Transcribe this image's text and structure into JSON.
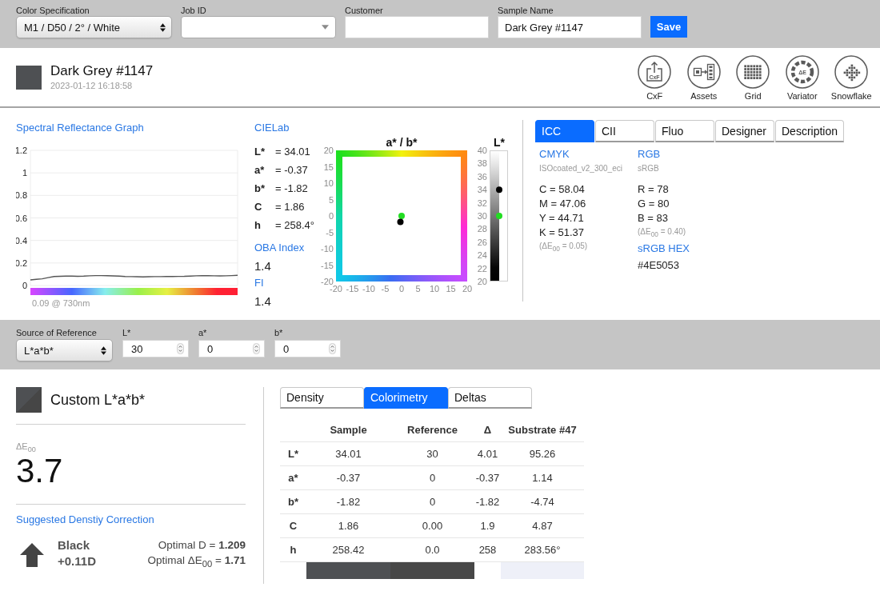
{
  "top_bar": {
    "fields": [
      {
        "kind": "select",
        "label": "Color Specification",
        "value": "M1 / D50 / 2° / White"
      },
      {
        "kind": "dropdown",
        "label": "Job ID"
      },
      {
        "kind": "text",
        "label": "Customer"
      },
      {
        "kind": "text",
        "label": "Sample Name",
        "value": "Dark Grey #1147"
      }
    ],
    "save_button": "Save"
  },
  "sample": {
    "color": "#4e5053",
    "name": "Dark Grey #1147",
    "timestamp": "2023-01-12 16:18:58"
  },
  "tools": [
    {
      "kind": "cxf",
      "label": "CxF",
      "icon_text": "CxF"
    },
    {
      "kind": "assets",
      "label": "Assets"
    },
    {
      "kind": "grid",
      "label": "Grid"
    },
    {
      "kind": "variator",
      "label": "Variator",
      "icon_text": "ΔE"
    },
    {
      "kind": "snowflake",
      "label": "Snowflake"
    }
  ],
  "spectral": {
    "title": "Spectral Reflectance Graph",
    "chart_data": {
      "type": "line",
      "grid": true,
      "ylim": [
        0,
        1.2
      ],
      "yticks": [
        0,
        0.2,
        0.4,
        0.6,
        0.8,
        1,
        1.2
      ],
      "series": [
        {
          "color": "#555555",
          "values": [
            0.05,
            0.055,
            0.06,
            0.07,
            0.08,
            0.082,
            0.083,
            0.083,
            0.082,
            0.083,
            0.086,
            0.088,
            0.088,
            0.087,
            0.085,
            0.083,
            0.08,
            0.079,
            0.078,
            0.077,
            0.078,
            0.079,
            0.079,
            0.08,
            0.08,
            0.081,
            0.082,
            0.084,
            0.086,
            0.087,
            0.087,
            0.086,
            0.085,
            0.086,
            0.088,
            0.09
          ]
        }
      ]
    },
    "reading": "0.09 @ 730nm"
  },
  "cielab": {
    "title": "CIELab",
    "rows": [
      {
        "label": "L*",
        "value": "= 34.01"
      },
      {
        "label": "a*",
        "value": "= -0.37"
      },
      {
        "label": "b*",
        "value": "= -1.82"
      },
      {
        "label": "C",
        "value": "= 1.86"
      },
      {
        "label": "h",
        "value": "= 258.4°"
      }
    ],
    "oba": {
      "title": "OBA Index",
      "value": "1.4"
    },
    "fi": {
      "title": "FI",
      "value": "1.4"
    }
  },
  "ab_plot": {
    "chart_data": {
      "type": "scatter",
      "title": "a* / b*",
      "xlim": [
        -20,
        20
      ],
      "ylim": [
        -20,
        20
      ],
      "xticks": [
        -20,
        -15,
        -10,
        -5,
        0,
        5,
        10,
        15,
        20
      ],
      "yticks": [
        -20,
        -15,
        -10,
        -5,
        0,
        5,
        10,
        15,
        20
      ],
      "series": [
        {
          "color": "#000000",
          "x": [
            -0.37
          ],
          "values": [
            -1.82
          ]
        },
        {
          "color": "#22dd22",
          "x": [
            0
          ],
          "values": [
            0
          ]
        }
      ]
    }
  },
  "l_scale": {
    "title": "L*",
    "ticks": [
      "40",
      "38",
      "36",
      "34",
      "32",
      "30",
      "28",
      "26",
      "24",
      "22",
      "20"
    ],
    "markers": [
      {
        "color": "#000000",
        "level": 0.7
      },
      {
        "color": "#22dd22",
        "level": 0.5
      }
    ]
  },
  "icc_panel": {
    "tabs": [
      {
        "label": "ICC",
        "selected": true
      },
      {
        "label": "CII",
        "selected": false
      },
      {
        "label": "Fluo",
        "selected": false
      },
      {
        "label": "Designer",
        "selected": false
      },
      {
        "label": "Description",
        "selected": false
      }
    ],
    "cmyk": {
      "title": "CMYK",
      "profile": "ISOcoated_v2_300_eci",
      "values": [
        "C = 58.04",
        "M = 47.06",
        "Y = 44.71",
        "K = 51.37"
      ],
      "delta": "(ΔE$_{00}$ = 0.05)"
    },
    "rgb": {
      "title": "RGB",
      "profile": "sRGB",
      "values": [
        "R = 78",
        "G = 80",
        "B = 83"
      ],
      "delta": "(ΔE$_{00}$ = 0.40)"
    },
    "hex": {
      "title": "sRGB HEX",
      "value": "#4E5053"
    }
  },
  "reference_bar": {
    "source": {
      "label": "Source of Reference",
      "value": "L*a*b*"
    },
    "inputs": [
      {
        "label": "L*",
        "value": "30"
      },
      {
        "label": "a*",
        "value": "0"
      },
      {
        "label": "b*",
        "value": "0"
      }
    ]
  },
  "reference": {
    "color": "#464646",
    "name": "Custom L*a*b*",
    "delta_label": "ΔE$_{00}$",
    "delta_value": "3.7",
    "correction": {
      "title": "Suggested Denstiy Correction",
      "increase": true,
      "ink": "Black",
      "adjustment": "+0.11D",
      "optimal": [
        "Optimal D = **1.209**",
        "Optimal ΔE$_{00}$ = **1.71**"
      ]
    }
  },
  "results": {
    "tabs": [
      {
        "label": "Density",
        "selected": false
      },
      {
        "label": "Colorimetry",
        "selected": true
      },
      {
        "label": "Deltas",
        "selected": false
      }
    ],
    "table": {
      "columns": [
        {
          "label": "Sample",
          "color": "#4e5053"
        },
        {
          "label": "Reference",
          "color": "#474747"
        },
        {
          "label": "Δ"
        },
        {
          "label": "Substrate #47",
          "color": "#eef0f8"
        }
      ],
      "rows": [
        {
          "label": "L*",
          "cells": [
            "34.01",
            "30",
            "4.01",
            "95.26"
          ]
        },
        {
          "label": "a*",
          "cells": [
            "-0.37",
            "0",
            "-0.37",
            "1.14"
          ]
        },
        {
          "label": "b*",
          "cells": [
            "-1.82",
            "0",
            "-1.82",
            "-4.74"
          ]
        },
        {
          "label": "C",
          "cells": [
            "1.86",
            "0.00",
            "1.9",
            "4.87"
          ]
        },
        {
          "label": "h",
          "cells": [
            "258.42",
            "0.0",
            "258",
            "283.56°"
          ]
        }
      ]
    }
  }
}
